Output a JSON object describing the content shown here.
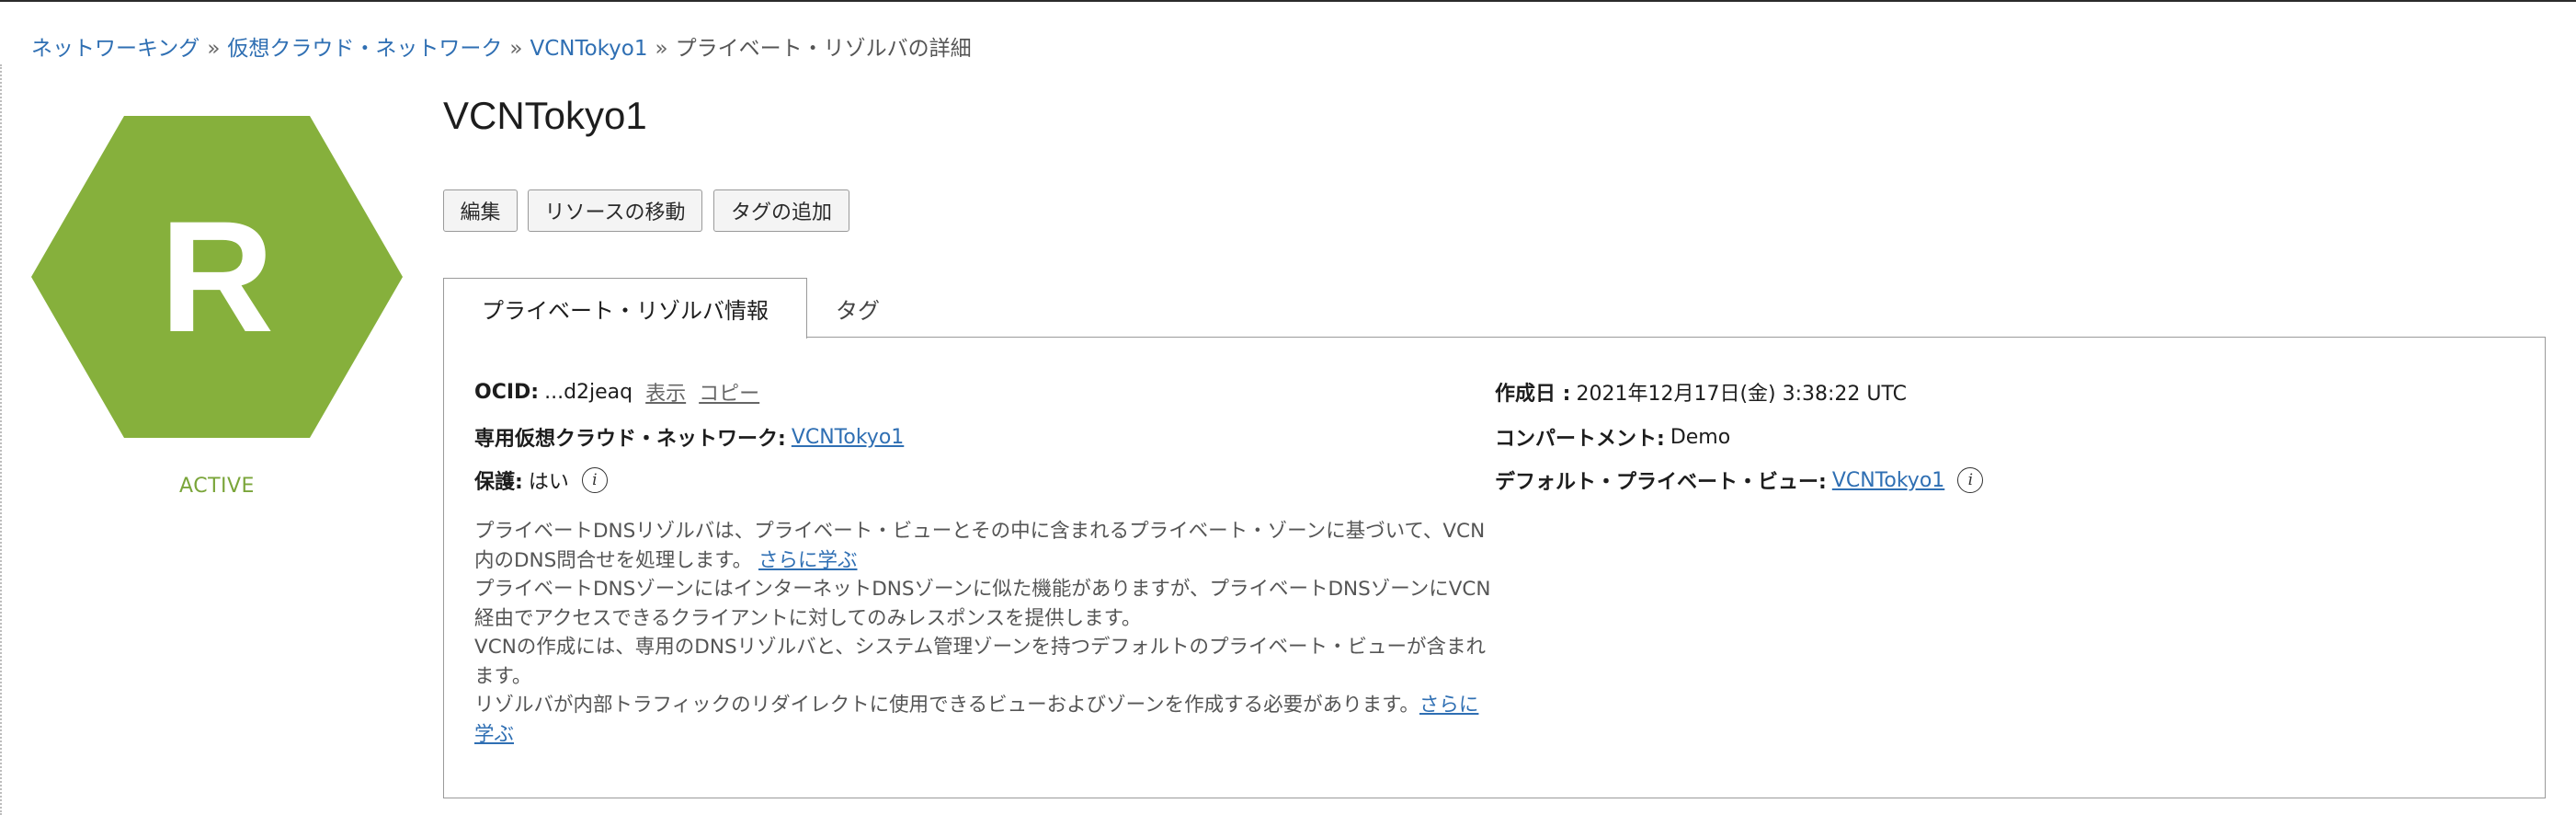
{
  "breadcrumb": {
    "items": [
      "ネットワーキング",
      "仮想クラウド・ネットワーク",
      "VCNTokyo1"
    ],
    "separator": "»",
    "current": "プライベート・リゾルバの詳細"
  },
  "resource": {
    "letter": "R",
    "status": "ACTIVE",
    "accent_color": "#86b03c",
    "status_color": "#7aa53a"
  },
  "page_title": "VCNTokyo1",
  "actions": {
    "edit": "編集",
    "move": "リソースの移動",
    "add_tag": "タグの追加"
  },
  "tabs": {
    "info": "プライベート・リゾルバ情報",
    "tags": "タグ"
  },
  "details": {
    "ocid_label": "OCID:",
    "ocid_value": "...d2jeaq",
    "ocid_show": "表示",
    "ocid_copy": "コピー",
    "vcn_label": "専用仮想クラウド・ネットワーク:",
    "vcn_value": "VCNTokyo1",
    "protected_label": "保護:",
    "protected_value": "はい",
    "created_label": "作成日 :",
    "created_value": "2021年12月17日(金) 3:38:22 UTC",
    "compartment_label": "コンパートメント:",
    "compartment_value": "Demo",
    "default_view_label": "デフォルト・プライベート・ビュー:",
    "default_view_value": "VCNTokyo1",
    "info_icon": "info-icon"
  },
  "description": {
    "p1": "プライベートDNSリゾルバは、プライベート・ビューとその中に含まれるプライベート・ゾーンに基づいて、VCN内のDNS問合せを処理します。",
    "p1_link": "さらに学ぶ",
    "p2": "プライベートDNSゾーンにはインターネットDNSゾーンに似た機能がありますが、プライベートDNSゾーンにVCN経由でアクセスできるクライアントに対してのみレスポンスを提供します。",
    "p3": "VCNの作成には、専用のDNSリゾルバと、システム管理ゾーンを持つデフォルトのプライベート・ビューが含まれます。",
    "p4": "リゾルバが内部トラフィックのリダイレクトに使用できるビューおよびゾーンを作成する必要があります。",
    "p4_link": "さらに学ぶ"
  }
}
